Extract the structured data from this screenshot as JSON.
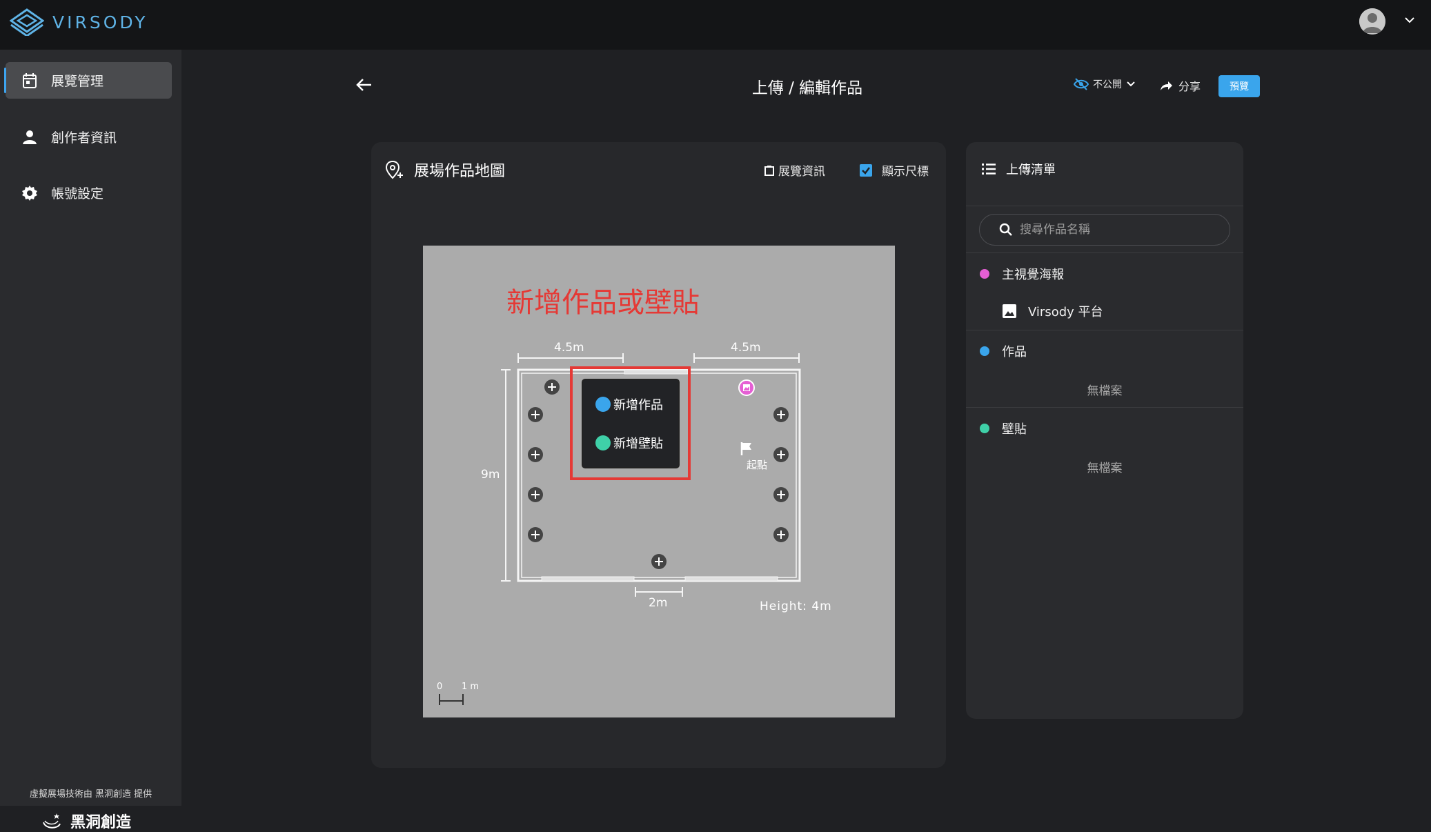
{
  "app": {
    "logo_text": "VIRSODY"
  },
  "sidebar": {
    "items": [
      {
        "label": "展覽管理",
        "icon": "calendar-icon",
        "active": true
      },
      {
        "label": "創作者資訊",
        "icon": "person-icon",
        "active": false
      },
      {
        "label": "帳號設定",
        "icon": "gear-icon",
        "active": false
      }
    ],
    "credit": "虛擬展場技術由 黑洞創造 提供",
    "brand": "黑洞創造"
  },
  "header": {
    "title": "上傳 / 編輯作品",
    "privacy": "不公開",
    "share": "分享",
    "preview": "預覽"
  },
  "map_card": {
    "title": "展場作品地圖",
    "info_link": "展覽資訊",
    "show_ruler_label": "顯示尺標",
    "show_ruler_checked": true,
    "map": {
      "hint": "新增作品或壁貼",
      "dim_top_left": "4.5m",
      "dim_top_right": "4.5m",
      "dim_left": "9m",
      "dim_bottom": "2m",
      "height": "Height: 4m",
      "start_label": "起點",
      "scale_zero": "0",
      "scale_one": "1 m",
      "popup": {
        "add_artwork": "新增作品",
        "add_sticker": "新增壁貼"
      }
    }
  },
  "upload_list": {
    "title": "上傳清單",
    "search_placeholder": "搜尋作品名稱",
    "categories": [
      {
        "label": "主視覺海報",
        "color": "#e55fd4"
      },
      {
        "label": "作品",
        "color": "#3aa5ec"
      },
      {
        "label": "壁貼",
        "color": "#3fd0a8"
      }
    ],
    "poster_file": "Virsody 平台",
    "empty_text": "無檔案"
  },
  "colors": {
    "accent": "#3aa5ec",
    "highlight": "#e53935"
  }
}
